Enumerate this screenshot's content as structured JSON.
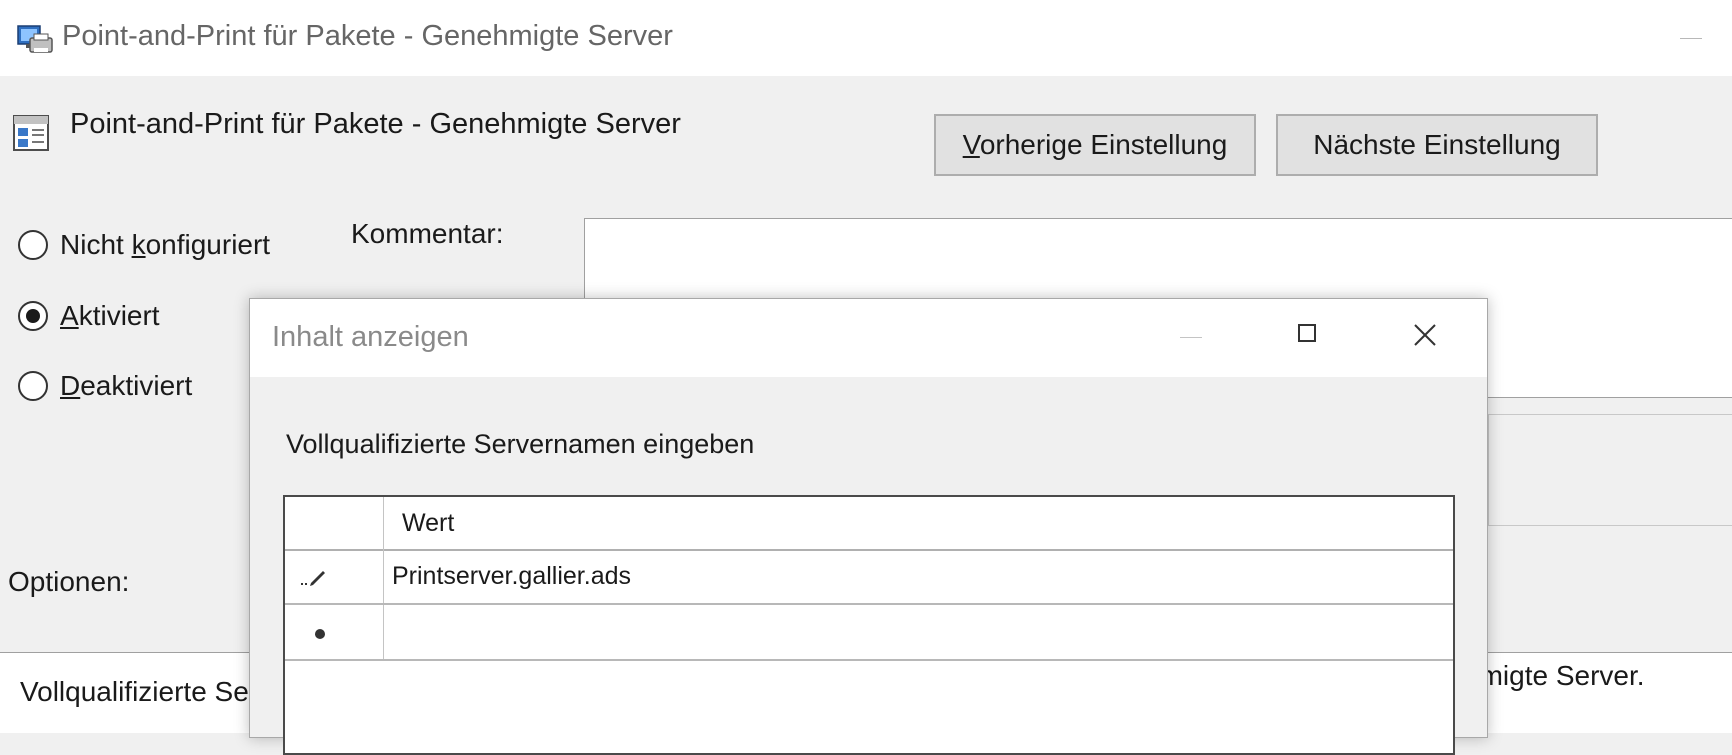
{
  "window": {
    "title": "Point-and-Print für Pakete - Genehmigte Server",
    "icon": "printer-network-icon"
  },
  "policy": {
    "title": "Point-and-Print für Pakete - Genehmigte Server",
    "icon": "policy-settings-icon",
    "prev_button": {
      "access_key": "V",
      "rest": "orherige Einstellung"
    },
    "next_button": "Nächste Einstellung"
  },
  "state": {
    "options": [
      {
        "pre": "Nicht ",
        "key": "k",
        "post": "onfiguriert",
        "checked": false
      },
      {
        "pre": "",
        "key": "A",
        "post": "ktiviert",
        "checked": true
      },
      {
        "pre": "",
        "key": "D",
        "post": "eaktiviert",
        "checked": false
      }
    ]
  },
  "comment_label": "Kommentar:",
  "options_label": "Optionen:",
  "options_panel": {
    "left_text": "Vollqualifizierte Se",
    "right_text": "hmigte Server."
  },
  "dialog": {
    "title": "Inhalt anzeigen",
    "instruction": "Vollqualifizierte Servernamen eingeben",
    "column_header": "Wert",
    "rows": [
      {
        "marker": "edit-pencil-icon",
        "value": "Printserver.gallier.ads"
      },
      {
        "marker": "new-row-icon",
        "value": ""
      }
    ]
  }
}
